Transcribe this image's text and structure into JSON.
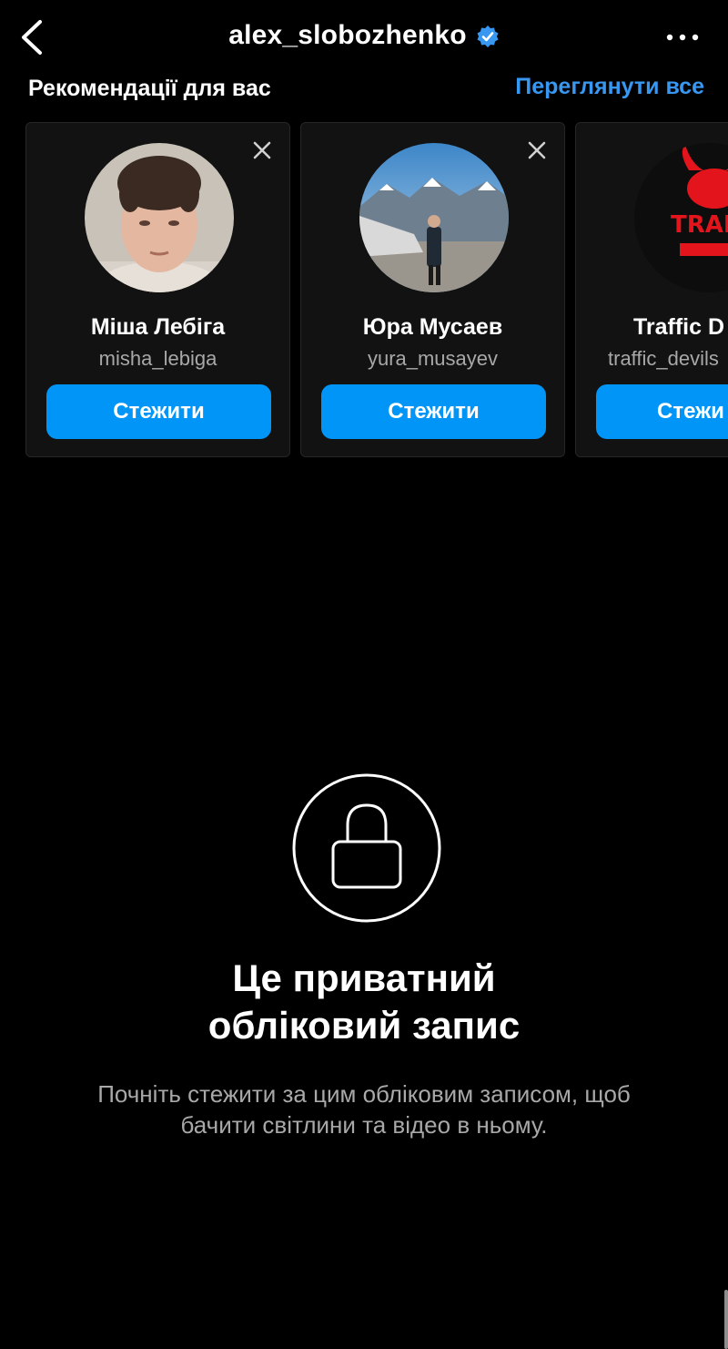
{
  "header": {
    "username": "alex_slobozhenko",
    "back_icon": "chevron-left-icon",
    "verified_icon": "verified-badge-icon",
    "more_icon": "more-horizontal-icon"
  },
  "suggestions": {
    "title": "Рекомендації для вас",
    "see_all": "Переглянути все",
    "cards": [
      {
        "name": "Міша Лебіга",
        "handle": "misha_lebiga",
        "button": "Стежити"
      },
      {
        "name": "Юра Мусаев",
        "handle": "yura_musayev",
        "button": "Стежити"
      },
      {
        "name": "Traffic D",
        "handle": "traffic_devils",
        "button": "Стежи",
        "avatar_text": "TRAFF DEV"
      }
    ]
  },
  "private": {
    "icon": "lock-icon",
    "title_line1": "Це приватний",
    "title_line2": "обліковий запис",
    "subtitle_line1": "Почніть стежити за цим обліковим записом, щоб",
    "subtitle_line2": "бачити світлини та відео в ньому."
  },
  "colors": {
    "background": "#000000",
    "accent": "#0095f6",
    "link": "#3897f0",
    "secondary_text": "#a8a8a8"
  }
}
